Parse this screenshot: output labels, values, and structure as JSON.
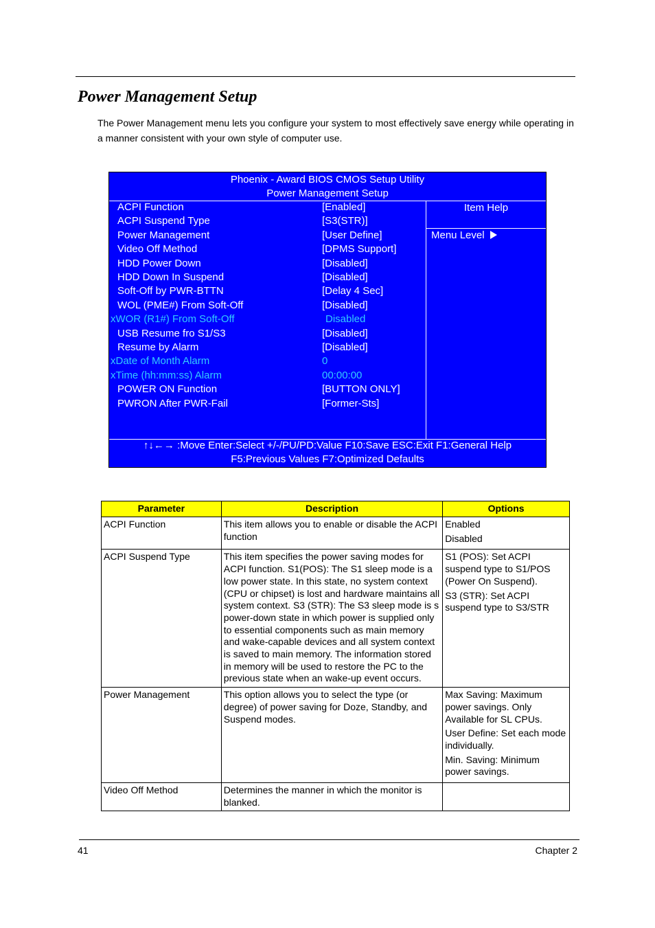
{
  "document": {
    "title": "Power Management Setup",
    "intro": "The Power Management menu lets you configure your system to most effectively save energy while operating in a manner consistent with your own style of computer use.",
    "page_number": "41",
    "chapter": "Chapter 2"
  },
  "bios": {
    "utility_title": "Phoenix - Award BIOS CMOS Setup Utility",
    "screen_title": "Power Management Setup",
    "colors": {
      "background": "#0000ff",
      "text": "#ffffff",
      "disabled_text": "#33ccff"
    },
    "items": [
      {
        "label": "ACPI Function",
        "value": "[Enabled]",
        "disabled": false
      },
      {
        "label": "ACPI Suspend Type",
        "value": "[S3(STR)]",
        "disabled": false
      },
      {
        "label": "Power Management",
        "value": "[User Define]",
        "disabled": false
      },
      {
        "label": "Video Off Method",
        "value": "[DPMS Support]",
        "disabled": false
      },
      {
        "label": "HDD Power Down",
        "value": "[Disabled]",
        "disabled": false
      },
      {
        "label": "HDD Down In Suspend",
        "value": "[Disabled]",
        "disabled": false
      },
      {
        "label": "Soft-Off by PWR-BTTN",
        "value": "[Delay 4 Sec]",
        "disabled": false
      },
      {
        "label": "WOL (PME#) From Soft-Off",
        "value": "[Disabled]",
        "disabled": false
      },
      {
        "label": "xWOR (R1#) From Soft-Off",
        "value": "Disabled",
        "disabled": true
      },
      {
        "label": "USB Resume fro S1/S3",
        "value": "[Disabled]",
        "disabled": false
      },
      {
        "label": "Resume by Alarm",
        "value": "[Disabled]",
        "disabled": false
      },
      {
        "label": "xDate of Month Alarm",
        "value": "0",
        "disabled": true
      },
      {
        "label": "xTime (hh:mm:ss) Alarm",
        "value": "00:00:00",
        "disabled": true
      },
      {
        "label": "POWER ON Function",
        "value": "[BUTTON ONLY]",
        "disabled": false
      },
      {
        "label": "PWRON After PWR-Fail",
        "value": "[Former-Sts]",
        "disabled": false
      }
    ],
    "item_help_title": "Item Help",
    "menu_level": "Menu Level",
    "menu_level_icon": "triangle-right-icon",
    "footer_line1": "↑↓←→ :Move  Enter:Select   +/-/PU/PD:Value  F10:Save  ESC:Exit  F1:General Help",
    "footer_line2": "F5:Previous Values  F7:Optimized Defaults"
  },
  "table": {
    "header_color": "#ffff00",
    "headers": [
      "Parameter",
      "Description",
      "Options"
    ],
    "rows": [
      {
        "parameter": "ACPI Function",
        "description": "This item allows you to enable or disable the ACPI function",
        "options": [
          "Enabled",
          "Disabled"
        ]
      },
      {
        "parameter": "ACPI Suspend Type",
        "description": "This item specifies the power saving modes for ACPI function. S1(POS): The S1 sleep mode is a low power state. In this state, no system context (CPU or chipset) is lost and hardware maintains all system context. S3 (STR): The S3 sleep mode is s power-down state in which power is supplied only to essential components such as main memory and wake-capable devices and all system context is saved to main memory. The information stored in memory will be used to restore the PC to the previous state when an wake-up event occurs.",
        "options": [
          "S1 (POS): Set ACPI suspend type to S1/POS (Power On Suspend).",
          "S3 (STR): Set ACPI suspend type to S3/STR"
        ]
      },
      {
        "parameter": "Power Management",
        "description": "This option allows you to select the type (or degree) of power saving for Doze, Standby, and Suspend modes.",
        "options": [
          "Max Saving: Maximum power savings. Only Available for SL CPUs.",
          "User Define: Set each mode individually.",
          "Min. Saving: Minimum power savings."
        ]
      },
      {
        "parameter": "Video Off Method",
        "description": "Determines the manner in which the monitor is blanked.",
        "options": []
      }
    ]
  }
}
